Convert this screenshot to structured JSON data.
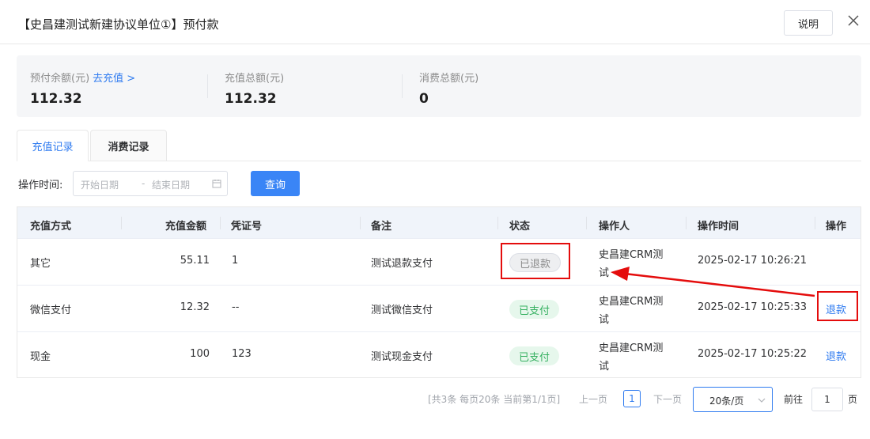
{
  "header": {
    "title": "【史昌建测试新建协议单位①】预付款",
    "explain_label": "说明"
  },
  "summary": {
    "balance_label": "预付余额(元)",
    "recharge_link": "去充值 >",
    "balance_value": "112.32",
    "recharge_total_label": "充值总额(元)",
    "recharge_total_value": "112.32",
    "consume_total_label": "消费总额(元)",
    "consume_total_value": "0"
  },
  "tabs": [
    "充值记录",
    "消费记录"
  ],
  "filter": {
    "label": "操作时间:",
    "start_placeholder": "开始日期",
    "separator": "-",
    "end_placeholder": "结束日期",
    "query_label": "查询"
  },
  "table": {
    "headers": [
      "充值方式",
      "充值金额",
      "凭证号",
      "备注",
      "状态",
      "操作人",
      "操作时间",
      "操作"
    ],
    "rows": [
      {
        "method": "其它",
        "amount": "55.11",
        "voucher": "1",
        "note": "测试退款支付",
        "status": "已退款",
        "operator_line1": "史昌建CRM测",
        "operator_line2": "试",
        "time": "2025-02-17 10:26:21",
        "action": ""
      },
      {
        "method": "微信支付",
        "amount": "12.32",
        "voucher": "--",
        "note": "测试微信支付",
        "status": "已支付",
        "operator_line1": "史昌建CRM测",
        "operator_line2": "试",
        "time": "2025-02-17 10:25:33",
        "action": "退款"
      },
      {
        "method": "现金",
        "amount": "100",
        "voucher": "123",
        "note": "测试现金支付",
        "status": "已支付",
        "operator_line1": "史昌建CRM测",
        "operator_line2": "试",
        "time": "2025-02-17 10:25:22",
        "action": "退款"
      }
    ]
  },
  "pagination": {
    "info": "[共3条 每页20条 当前第1/1页]",
    "prev": "上一页",
    "current_page": "1",
    "next": "下一页",
    "page_size": "20条/页",
    "goto_label": "前往",
    "goto_value": "1",
    "page_suffix": "页"
  },
  "colors": {
    "accent": "#2f7bf0",
    "paid": "#35b060",
    "annotation_red": "#e40c0c"
  }
}
